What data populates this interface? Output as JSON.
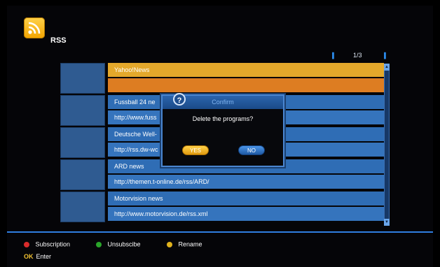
{
  "header": {
    "title": "RSS",
    "icon": "rss-icon",
    "accent": "#f2a400"
  },
  "pager": {
    "page": "1/3"
  },
  "feeds": [
    {
      "name": "Yahoo!News",
      "url": "",
      "selected": true
    },
    {
      "name": "Fussball 24 ne",
      "url": "http://www.fuss",
      "selected": false
    },
    {
      "name": "Deutsche Well-",
      "url": "http://rss.dw-wc",
      "selected": false
    },
    {
      "name": "ARD news",
      "url": "http://themen.t-online.de/rss/ARD/",
      "selected": false
    },
    {
      "name": "Motorvision news",
      "url": "http://www.motorvision.de/rss.xml",
      "selected": false
    }
  ],
  "dialog": {
    "title": "Confirm",
    "message": "Delete the programs?",
    "yes_label": "YES",
    "no_label": "NO",
    "icon": "question-icon"
  },
  "legend": {
    "red": {
      "label": "Subscription",
      "color": "#d92b2b"
    },
    "green": {
      "label": "Unsubscibe",
      "color": "#2aa52a"
    },
    "yellow": {
      "label": "Rename",
      "color": "#e0b21c"
    },
    "ok": {
      "key": "OK",
      "label": "Enter"
    }
  },
  "colors": {
    "row_blue": "#2f6db5",
    "row_yellow": "#e4a82b",
    "row_orange": "#dd7d22",
    "line_blue": "#2f7ee0"
  }
}
